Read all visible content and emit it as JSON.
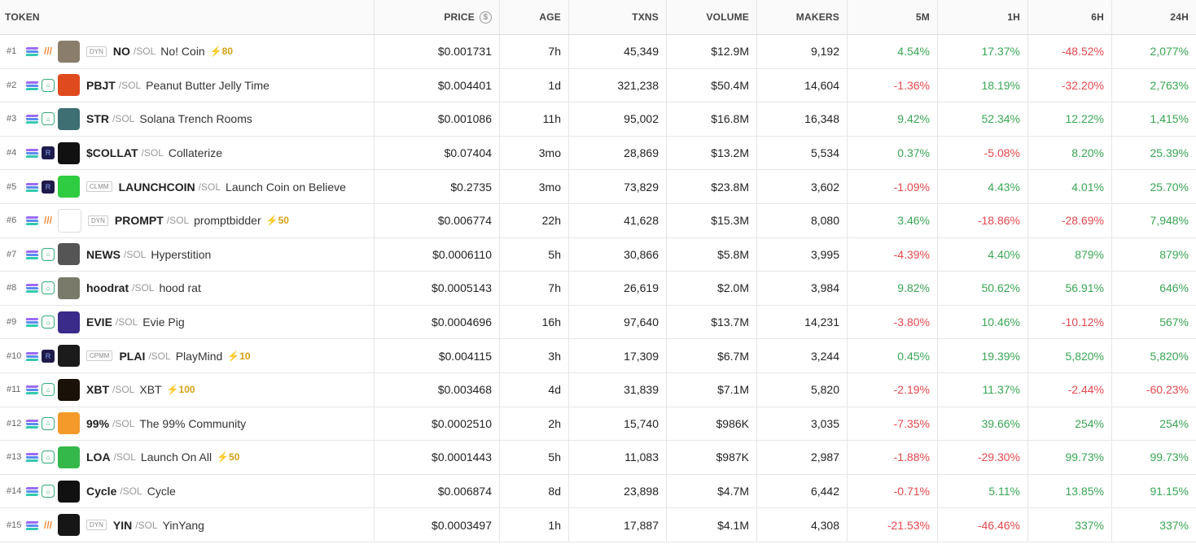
{
  "headers": {
    "token": "TOKEN",
    "price": "PRICE",
    "age": "AGE",
    "txns": "TXNS",
    "volume": "VOLUME",
    "makers": "MAKERS",
    "m5": "5M",
    "h1": "1H",
    "h6": "6H",
    "h24": "24H"
  },
  "price_icon": "dollar-circle-icon",
  "colors": {
    "positive": "#3aa655",
    "negative": "#e5484d",
    "boost": "#d4a017"
  },
  "rows": [
    {
      "rank": "#1",
      "dex": "meteora",
      "badge": "DYN",
      "symbol": "NO",
      "chain": "/SOL",
      "name": "No! Coin",
      "boost": "⚡80",
      "avatar": "#8b7d6b",
      "price": "$0.001731",
      "age": "7h",
      "txns": "45,349",
      "volume": "$12.9M",
      "makers": "9,192",
      "m5": "4.54%",
      "h1": "17.37%",
      "h6": "-48.52%",
      "h24": "2,077%"
    },
    {
      "rank": "#2",
      "dex": "pump",
      "badge": "",
      "symbol": "PBJT",
      "chain": "/SOL",
      "name": "Peanut Butter Jelly Time",
      "boost": "",
      "avatar": "#e04a1f",
      "price": "$0.004401",
      "age": "1d",
      "txns": "321,238",
      "volume": "$50.4M",
      "makers": "14,604",
      "m5": "-1.36%",
      "h1": "18.19%",
      "h6": "-32.20%",
      "h24": "2,763%"
    },
    {
      "rank": "#3",
      "dex": "pump",
      "badge": "",
      "symbol": "STR",
      "chain": "/SOL",
      "name": "Solana Trench Rooms",
      "boost": "",
      "avatar": "#3d6f73",
      "price": "$0.001086",
      "age": "11h",
      "txns": "95,002",
      "volume": "$16.8M",
      "makers": "16,348",
      "m5": "9.42%",
      "h1": "52.34%",
      "h6": "12.22%",
      "h24": "1,415%"
    },
    {
      "rank": "#4",
      "dex": "raydium",
      "badge": "",
      "symbol": "$COLLAT",
      "chain": "/SOL",
      "name": "Collaterize",
      "boost": "",
      "avatar": "#111111",
      "price": "$0.07404",
      "age": "3mo",
      "txns": "28,869",
      "volume": "$13.2M",
      "makers": "5,534",
      "m5": "0.37%",
      "h1": "-5.08%",
      "h6": "8.20%",
      "h24": "25.39%"
    },
    {
      "rank": "#5",
      "dex": "raydium",
      "badge": "CLMM",
      "symbol": "LAUNCHCOIN",
      "chain": "/SOL",
      "name": "Launch Coin on Believe",
      "boost": "",
      "avatar": "#2ecc40",
      "price": "$0.2735",
      "age": "3mo",
      "txns": "73,829",
      "volume": "$23.8M",
      "makers": "3,602",
      "m5": "-1.09%",
      "h1": "4.43%",
      "h6": "4.01%",
      "h24": "25.70%"
    },
    {
      "rank": "#6",
      "dex": "meteora",
      "badge": "DYN",
      "symbol": "PROMPT",
      "chain": "/SOL",
      "name": "promptbidder",
      "boost": "⚡50",
      "avatar": "#ffffff",
      "price": "$0.006774",
      "age": "22h",
      "txns": "41,628",
      "volume": "$15.3M",
      "makers": "8,080",
      "m5": "3.46%",
      "h1": "-18.86%",
      "h6": "-28.69%",
      "h24": "7,948%"
    },
    {
      "rank": "#7",
      "dex": "pump",
      "badge": "",
      "symbol": "NEWS",
      "chain": "/SOL",
      "name": "Hyperstition",
      "boost": "",
      "avatar": "#555555",
      "price": "$0.0006110",
      "age": "5h",
      "txns": "30,866",
      "volume": "$5.8M",
      "makers": "3,995",
      "m5": "-4.39%",
      "h1": "4.40%",
      "h6": "879%",
      "h24": "879%"
    },
    {
      "rank": "#8",
      "dex": "pump",
      "badge": "",
      "symbol": "hoodrat",
      "chain": "/SOL",
      "name": "hood rat",
      "boost": "",
      "avatar": "#7a7a6a",
      "price": "$0.0005143",
      "age": "7h",
      "txns": "26,619",
      "volume": "$2.0M",
      "makers": "3,984",
      "m5": "9.82%",
      "h1": "50.62%",
      "h6": "56.91%",
      "h24": "646%"
    },
    {
      "rank": "#9",
      "dex": "pump",
      "badge": "",
      "symbol": "EVIE",
      "chain": "/SOL",
      "name": "Evie Pig",
      "boost": "",
      "avatar": "#3a2a8a",
      "price": "$0.0004696",
      "age": "16h",
      "txns": "97,640",
      "volume": "$13.7M",
      "makers": "14,231",
      "m5": "-3.80%",
      "h1": "10.46%",
      "h6": "-10.12%",
      "h24": "567%"
    },
    {
      "rank": "#10",
      "dex": "raydium",
      "badge": "CPMM",
      "symbol": "PLAI",
      "chain": "/SOL",
      "name": "PlayMind",
      "boost": "⚡10",
      "avatar": "#1b1b1b",
      "price": "$0.004115",
      "age": "3h",
      "txns": "17,309",
      "volume": "$6.7M",
      "makers": "3,244",
      "m5": "0.45%",
      "h1": "19.39%",
      "h6": "5,820%",
      "h24": "5,820%"
    },
    {
      "rank": "#11",
      "dex": "pump",
      "badge": "",
      "symbol": "XBT",
      "chain": "/SOL",
      "name": "XBT",
      "boost": "⚡100",
      "avatar": "#1a1208",
      "price": "$0.003468",
      "age": "4d",
      "txns": "31,839",
      "volume": "$7.1M",
      "makers": "5,820",
      "m5": "-2.19%",
      "h1": "11.37%",
      "h6": "-2.44%",
      "h24": "-60.23%"
    },
    {
      "rank": "#12",
      "dex": "pump",
      "badge": "",
      "symbol": "99%",
      "chain": "/SOL",
      "name": "The 99% Community",
      "boost": "",
      "avatar": "#f39a2b",
      "price": "$0.0002510",
      "age": "2h",
      "txns": "15,740",
      "volume": "$986K",
      "makers": "3,035",
      "m5": "-7.35%",
      "h1": "39.66%",
      "h6": "254%",
      "h24": "254%"
    },
    {
      "rank": "#13",
      "dex": "pump",
      "badge": "",
      "symbol": "LOA",
      "chain": "/SOL",
      "name": "Launch On All",
      "boost": "⚡50",
      "avatar": "#34b84a",
      "price": "$0.0001443",
      "age": "5h",
      "txns": "11,083",
      "volume": "$987K",
      "makers": "2,987",
      "m5": "-1.88%",
      "h1": "-29.30%",
      "h6": "99.73%",
      "h24": "99.73%"
    },
    {
      "rank": "#14",
      "dex": "pump",
      "badge": "",
      "symbol": "Cycle",
      "chain": "/SOL",
      "name": "Cycle",
      "boost": "",
      "avatar": "#111111",
      "price": "$0.006874",
      "age": "8d",
      "txns": "23,898",
      "volume": "$4.7M",
      "makers": "6,442",
      "m5": "-0.71%",
      "h1": "5.11%",
      "h6": "13.85%",
      "h24": "91.15%"
    },
    {
      "rank": "#15",
      "dex": "meteora",
      "badge": "DYN",
      "symbol": "YIN",
      "chain": "/SOL",
      "name": "YinYang",
      "boost": "",
      "avatar": "#161616",
      "price": "$0.0003497",
      "age": "1h",
      "txns": "17,887",
      "volume": "$4.1M",
      "makers": "4,308",
      "m5": "-21.53%",
      "h1": "-46.46%",
      "h6": "337%",
      "h24": "337%"
    }
  ]
}
